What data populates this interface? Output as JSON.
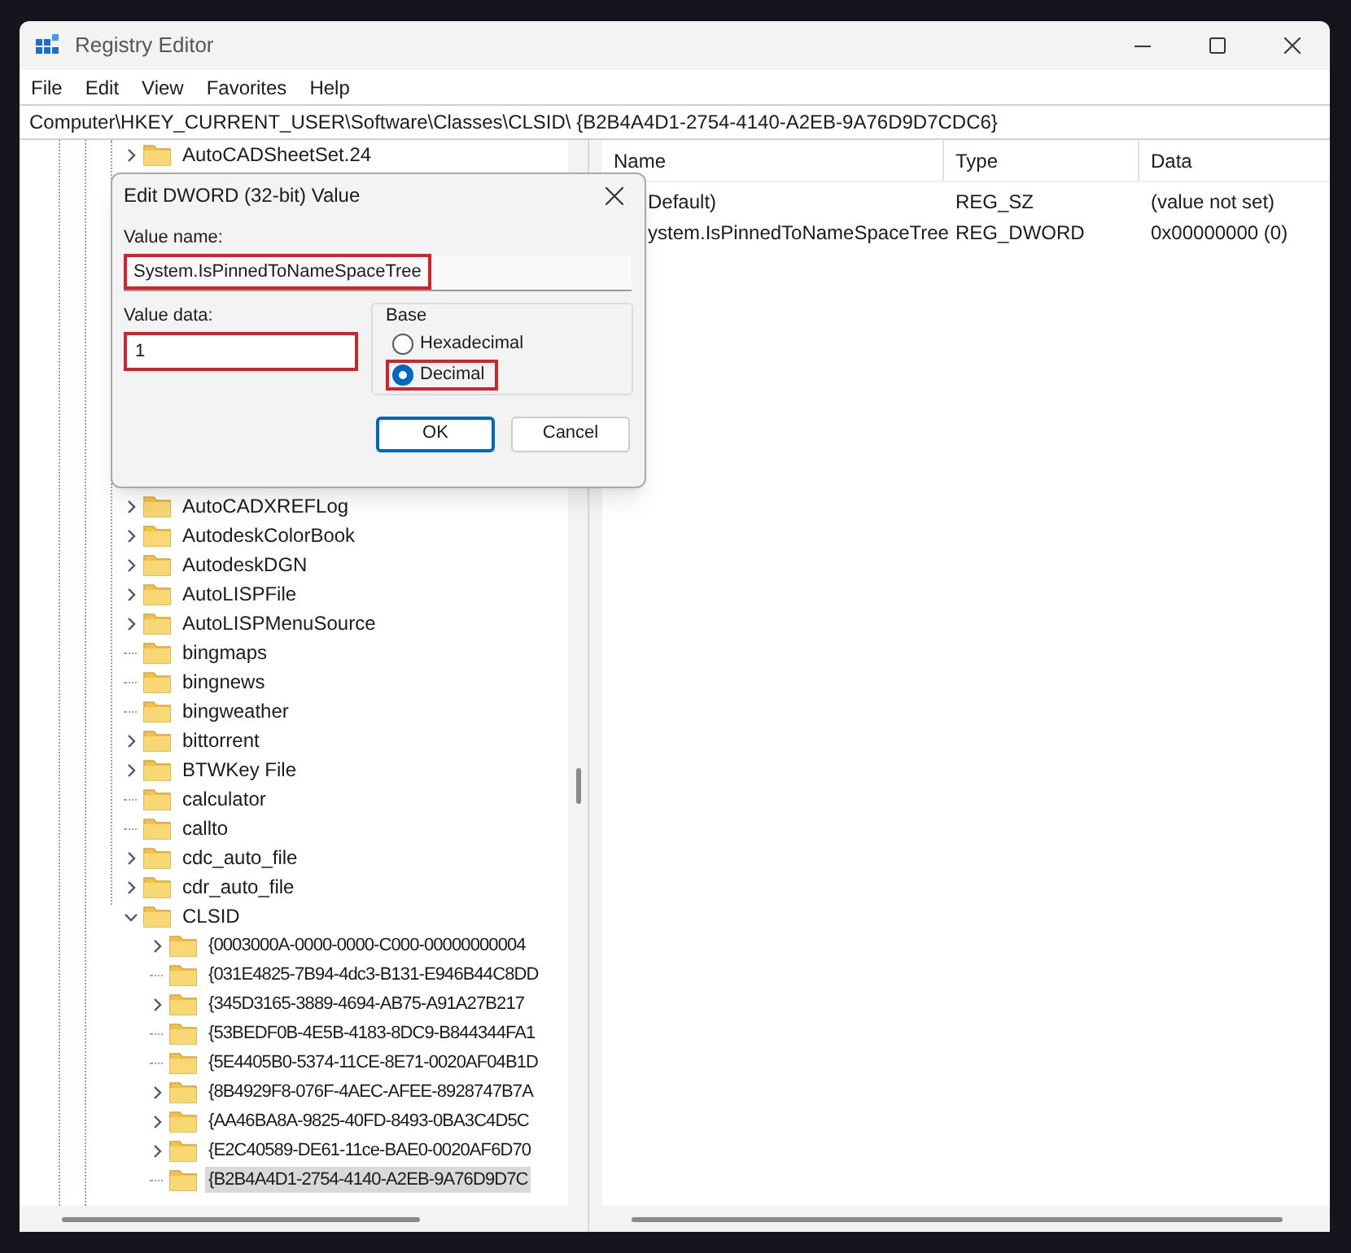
{
  "window": {
    "title": "Registry Editor"
  },
  "menu": [
    "File",
    "Edit",
    "View",
    "Favorites",
    "Help"
  ],
  "address": "Computer\\HKEY_CURRENT_USER\\Software\\Classes\\CLSID\\ {B2B4A4D1-2754-4140-A2EB-9A76D9D7CDC6}",
  "tree": {
    "top_items": [
      {
        "label": "AutoCADSheetSet.24",
        "has_children": true,
        "expanded": false,
        "selected": false
      }
    ],
    "items": [
      {
        "label": "AutoCADXREFLog",
        "has_children": true,
        "expanded": false,
        "selected": false
      },
      {
        "label": "AutodeskColorBook",
        "has_children": true,
        "expanded": false,
        "selected": false
      },
      {
        "label": "AutodeskDGN",
        "has_children": true,
        "expanded": false,
        "selected": false
      },
      {
        "label": "AutoLISPFile",
        "has_children": true,
        "expanded": false,
        "selected": false
      },
      {
        "label": "AutoLISPMenuSource",
        "has_children": true,
        "expanded": false,
        "selected": false
      },
      {
        "label": "bingmaps",
        "has_children": false,
        "selected": false
      },
      {
        "label": "bingnews",
        "has_children": false,
        "selected": false
      },
      {
        "label": "bingweather",
        "has_children": false,
        "selected": false
      },
      {
        "label": "bittorrent",
        "has_children": true,
        "expanded": false,
        "selected": false
      },
      {
        "label": "BTWKey File",
        "has_children": true,
        "expanded": false,
        "selected": false
      },
      {
        "label": "calculator",
        "has_children": false,
        "selected": false
      },
      {
        "label": "callto",
        "has_children": false,
        "selected": false
      },
      {
        "label": "cdc_auto_file",
        "has_children": true,
        "expanded": false,
        "selected": false
      },
      {
        "label": "cdr_auto_file",
        "has_children": true,
        "expanded": false,
        "selected": false
      },
      {
        "label": "CLSID",
        "has_children": true,
        "expanded": true,
        "selected": false,
        "children": [
          {
            "label": "{0003000A-0000-0000-C000-00000000004",
            "has_children": true,
            "expanded": false,
            "selected": false
          },
          {
            "label": "{031E4825-7B94-4dc3-B131-E946B44C8DD",
            "has_children": false,
            "selected": false
          },
          {
            "label": "{345D3165-3889-4694-AB75-A91A27B217",
            "has_children": true,
            "expanded": false,
            "selected": false
          },
          {
            "label": "{53BEDF0B-4E5B-4183-8DC9-B844344FA1",
            "has_children": false,
            "selected": false
          },
          {
            "label": "{5E4405B0-5374-11CE-8E71-0020AF04B1D",
            "has_children": false,
            "selected": false
          },
          {
            "label": "{8B4929F8-076F-4AEC-AFEE-8928747B7A",
            "has_children": true,
            "expanded": false,
            "selected": false
          },
          {
            "label": "{AA46BA8A-9825-40FD-8493-0BA3C4D5C",
            "has_children": true,
            "expanded": false,
            "selected": false
          },
          {
            "label": "{E2C40589-DE61-11ce-BAE0-0020AF6D70",
            "has_children": true,
            "expanded": false,
            "selected": false
          },
          {
            "label": "{B2B4A4D1-2754-4140-A2EB-9A76D9D7C",
            "has_children": false,
            "selected": true
          }
        ]
      }
    ]
  },
  "values": {
    "columns": [
      "Name",
      "Type",
      "Data"
    ],
    "rows": [
      {
        "name": "Default)",
        "type": "REG_SZ",
        "data": "(value not set)"
      },
      {
        "name": "ystem.IsPinnedToNameSpaceTree",
        "type": "REG_DWORD",
        "data": "0x00000000 (0)"
      }
    ]
  },
  "dialog": {
    "title": "Edit DWORD (32-bit) Value",
    "value_name_label": "Value name:",
    "value_name": "System.IsPinnedToNameSpaceTree",
    "value_name_highlighted": true,
    "value_data_label": "Value data:",
    "value_data": "1",
    "value_data_highlighted": true,
    "base_label": "Base",
    "base_options": [
      {
        "label": "Hexadecimal",
        "selected": false,
        "highlighted": false
      },
      {
        "label": "Decimal",
        "selected": true,
        "highlighted": true
      }
    ],
    "buttons": [
      {
        "label": "OK",
        "kind": "default"
      },
      {
        "label": "Cancel",
        "kind": "normal"
      }
    ]
  }
}
